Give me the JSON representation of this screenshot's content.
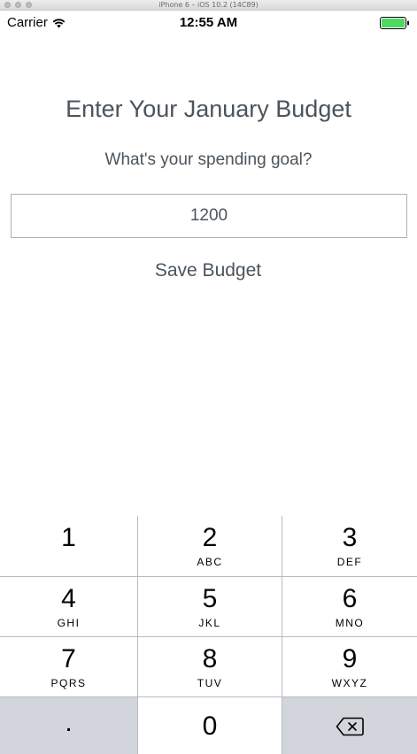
{
  "simulator": {
    "title": "iPhone 6 – iOS 10.2 (14C89)"
  },
  "status_bar": {
    "carrier": "Carrier",
    "time": "12:55 AM",
    "battery_color": "#4cd964"
  },
  "main": {
    "title": "Enter Your January Budget",
    "subtitle": "What's your spending goal?",
    "budget_value": "1200",
    "save_label": "Save Budget",
    "text_color": "#4b545c"
  },
  "keypad": {
    "keys": [
      {
        "digit": "1",
        "letters": ""
      },
      {
        "digit": "2",
        "letters": "ABC"
      },
      {
        "digit": "3",
        "letters": "DEF"
      },
      {
        "digit": "4",
        "letters": "GHI"
      },
      {
        "digit": "5",
        "letters": "JKL"
      },
      {
        "digit": "6",
        "letters": "MNO"
      },
      {
        "digit": "7",
        "letters": "PQRS"
      },
      {
        "digit": "8",
        "letters": "TUV"
      },
      {
        "digit": "9",
        "letters": "WXYZ"
      },
      {
        "digit": ".",
        "letters": ""
      },
      {
        "digit": "0",
        "letters": ""
      },
      {
        "digit": "",
        "letters": "",
        "icon": "backspace-icon"
      }
    ]
  }
}
